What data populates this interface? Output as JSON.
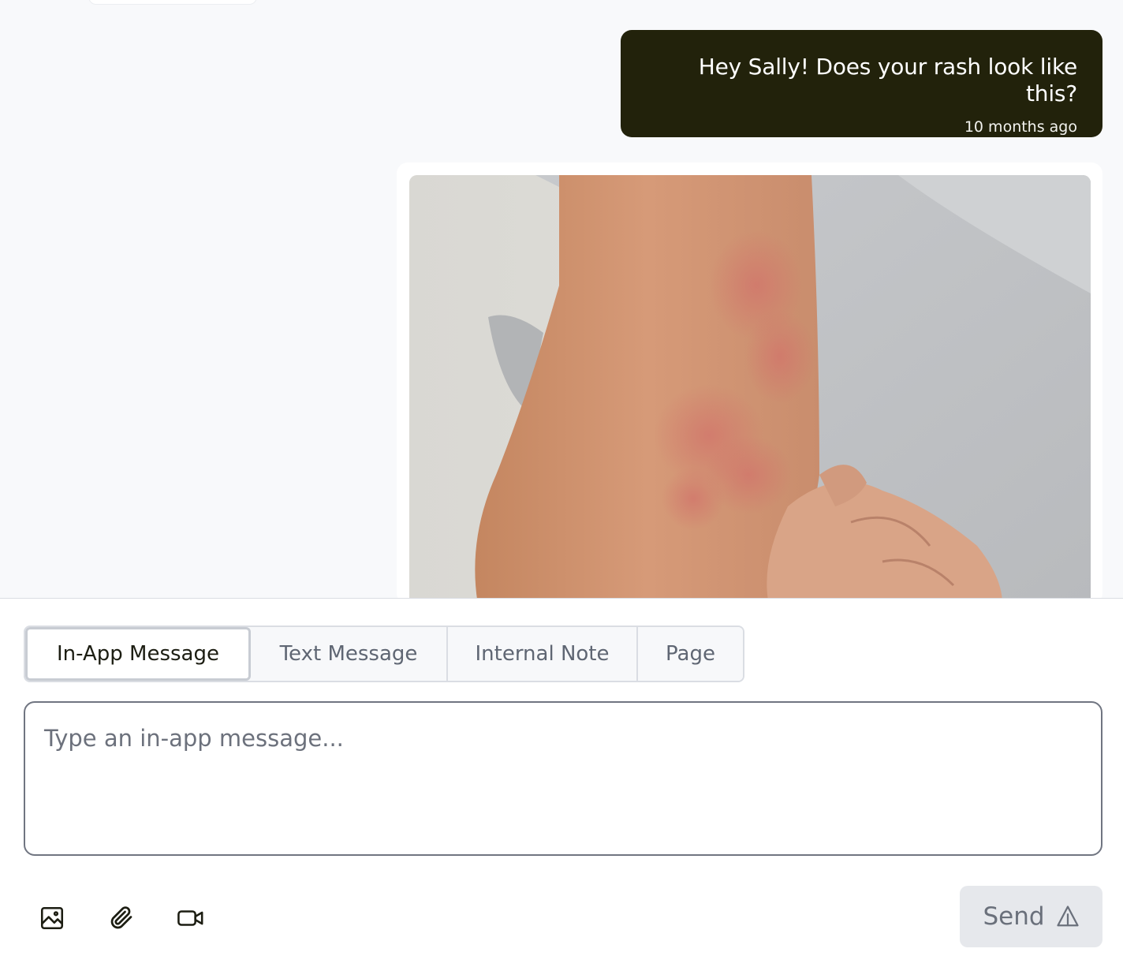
{
  "conversation": {
    "outgoing_message": {
      "text": "Hey Sally! Does your rash look like this?",
      "timestamp": "10 months ago"
    },
    "image_attachment": {
      "description_icon": "photo-of-arm-rash"
    }
  },
  "composer": {
    "tabs": [
      {
        "label": "In-App Message",
        "active": true
      },
      {
        "label": "Text Message",
        "active": false
      },
      {
        "label": "Internal Note",
        "active": false
      },
      {
        "label": "Page",
        "active": false
      }
    ],
    "input_placeholder": "Type an in-app message...",
    "toolbar": {
      "image_icon": "image-icon",
      "attach_icon": "paperclip-icon",
      "video_icon": "video-camera-icon"
    },
    "send_label": "Send",
    "send_icon": "send-icon"
  },
  "colors": {
    "bubble_bg": "#22220b",
    "page_bg": "#f8f9fb",
    "send_bg": "#e6e8ec"
  }
}
